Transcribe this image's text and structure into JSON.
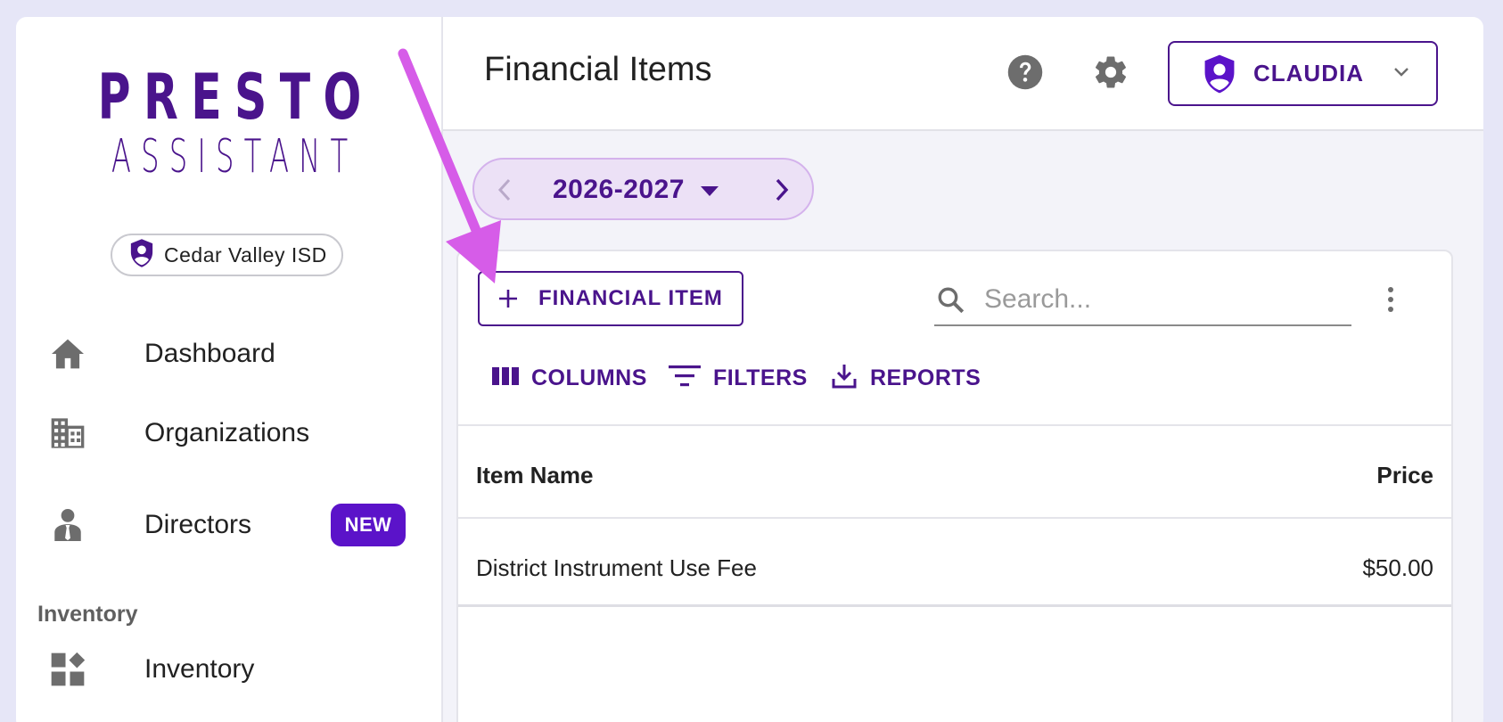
{
  "sidebar": {
    "logo_line1": "PRESTO",
    "logo_line2": "ASSISTANT",
    "organization": "Cedar Valley ISD",
    "nav": [
      {
        "label": "Dashboard",
        "icon": "home-icon"
      },
      {
        "label": "Organizations",
        "icon": "building-icon"
      },
      {
        "label": "Directors",
        "icon": "director-icon",
        "badge": "NEW"
      },
      {
        "label": "Inventory",
        "icon": "inventory-icon"
      }
    ],
    "section_inventory": "Inventory"
  },
  "header": {
    "title": "Financial Items",
    "user_name": "CLAUDIA"
  },
  "year_selector": {
    "value": "2026-2027"
  },
  "toolbar": {
    "add_label": "FINANCIAL ITEM",
    "search_placeholder": "Search...",
    "columns_label": "COLUMNS",
    "filters_label": "FILTERS",
    "reports_label": "REPORTS"
  },
  "table": {
    "columns": [
      "Item Name",
      "Price"
    ],
    "rows": [
      {
        "item_name": "District Instrument Use Fee",
        "price": "$50.00"
      }
    ]
  },
  "colors": {
    "brand": "#4a148c",
    "badge": "#5b13c9",
    "annotation_arrow": "#d65ce8"
  }
}
